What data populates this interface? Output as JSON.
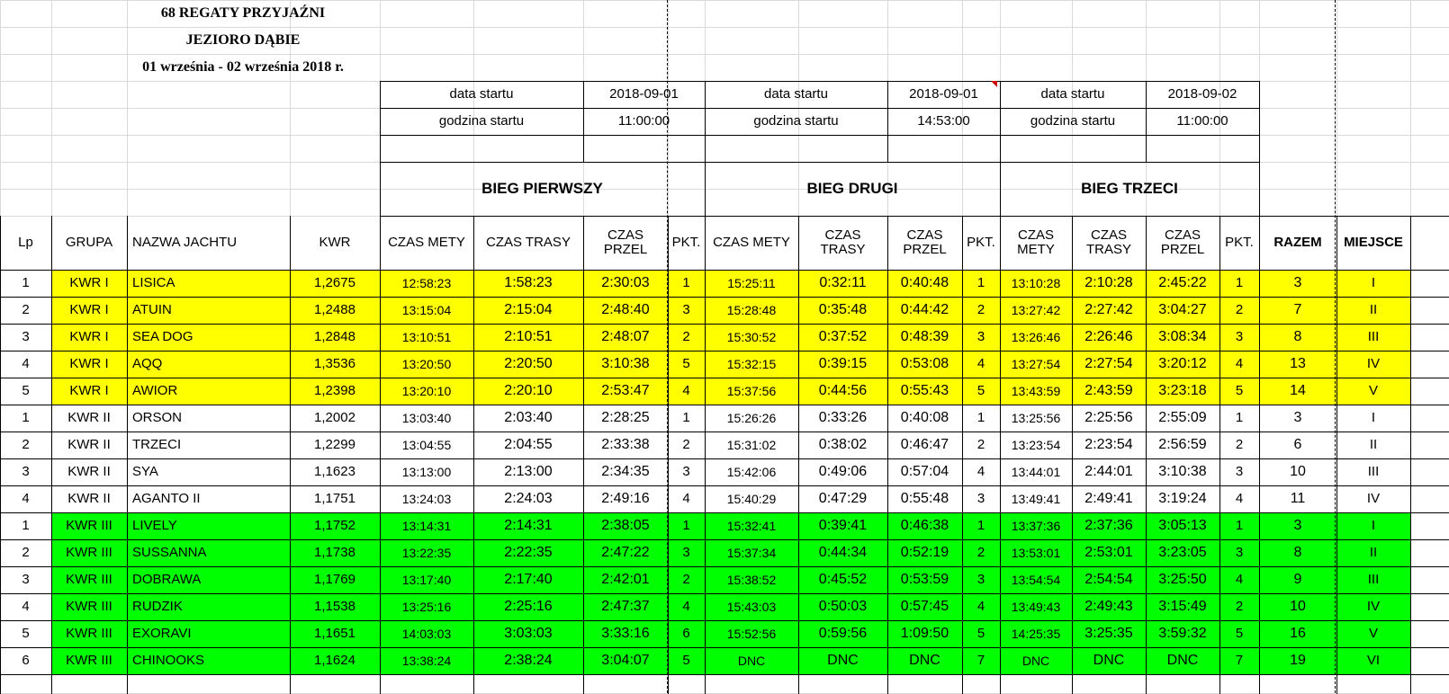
{
  "title": {
    "line1": "68 REGATY PRZYJAŹNI",
    "line2": "JEZIORO DĄBIE",
    "line3": "01 września -  02 września 2018 r."
  },
  "starts": [
    {
      "date_label": "data startu",
      "date": "2018-09-01",
      "time_label": "godzina startu",
      "time": "11:00:00",
      "race": "BIEG PIERWSZY"
    },
    {
      "date_label": "data startu",
      "date": "2018-09-01",
      "time_label": "godzina startu",
      "time": "14:53:00",
      "race": "BIEG  DRUGI"
    },
    {
      "date_label": "data startu",
      "date": "2018-09-02",
      "time_label": "godzina startu",
      "time": "11:00:00",
      "race": "BIEG TRZECI"
    }
  ],
  "columns": [
    "Lp",
    "GRUPA",
    "NAZWA JACHTU",
    "KWR",
    "CZAS METY",
    "CZAS TRASY",
    "CZAS PRZEL",
    "PKT.",
    "CZAS METY",
    "CZAS TRASY",
    "CZAS PRZEL",
    "PKT.",
    "CZAS METY",
    "CZAS TRASY",
    "CZAS PRZEL",
    "PKT.",
    "RAZEM",
    "MIEJSCE"
  ],
  "colors": {
    "kwr1": "#ffff00",
    "kwr2": "#ffffff",
    "kwr3": "#00ff00",
    "grid": "#d9d9d9"
  },
  "rows": [
    {
      "cells": [
        "1",
        "KWR I",
        "LISICA",
        "1,2675",
        "12:58:23",
        "1:58:23",
        "2:30:03",
        "1",
        "15:25:11",
        "0:32:11",
        "0:40:48",
        "1",
        "13:10:28",
        "2:10:28",
        "2:45:22",
        "1",
        "3",
        "I"
      ],
      "group": "kwr1"
    },
    {
      "cells": [
        "2",
        "KWR I",
        "ATUIN",
        "1,2488",
        "13:15:04",
        "2:15:04",
        "2:48:40",
        "3",
        "15:28:48",
        "0:35:48",
        "0:44:42",
        "2",
        "13:27:42",
        "2:27:42",
        "3:04:27",
        "2",
        "7",
        "II"
      ],
      "group": "kwr1"
    },
    {
      "cells": [
        "3",
        "KWR I",
        "SEA DOG",
        "1,2848",
        "13:10:51",
        "2:10:51",
        "2:48:07",
        "2",
        "15:30:52",
        "0:37:52",
        "0:48:39",
        "3",
        "13:26:46",
        "2:26:46",
        "3:08:34",
        "3",
        "8",
        "III"
      ],
      "group": "kwr1"
    },
    {
      "cells": [
        "4",
        "KWR I",
        "AQQ",
        "1,3536",
        "13:20:50",
        "2:20:50",
        "3:10:38",
        "5",
        "15:32:15",
        "0:39:15",
        "0:53:08",
        "4",
        "13:27:54",
        "2:27:54",
        "3:20:12",
        "4",
        "13",
        "IV"
      ],
      "group": "kwr1"
    },
    {
      "cells": [
        "5",
        "KWR I",
        "AWIOR",
        "1,2398",
        "13:20:10",
        "2:20:10",
        "2:53:47",
        "4",
        "15:37:56",
        "0:44:56",
        "0:55:43",
        "5",
        "13:43:59",
        "2:43:59",
        "3:23:18",
        "5",
        "14",
        "V"
      ],
      "group": "kwr1"
    },
    {
      "cells": [
        "1",
        "KWR II",
        "ORSON",
        "1,2002",
        "13:03:40",
        "2:03:40",
        "2:28:25",
        "1",
        "15:26:26",
        "0:33:26",
        "0:40:08",
        "1",
        "13:25:56",
        "2:25:56",
        "2:55:09",
        "1",
        "3",
        "I"
      ],
      "group": "kwr2"
    },
    {
      "cells": [
        "2",
        "KWR II",
        "TRZECI",
        "1,2299",
        "13:04:55",
        "2:04:55",
        "2:33:38",
        "2",
        "15:31:02",
        "0:38:02",
        "0:46:47",
        "2",
        "13:23:54",
        "2:23:54",
        "2:56:59",
        "2",
        "6",
        "II"
      ],
      "group": "kwr2"
    },
    {
      "cells": [
        "3",
        "KWR II",
        "SYA",
        "1,1623",
        "13:13:00",
        "2:13:00",
        "2:34:35",
        "3",
        "15:42:06",
        "0:49:06",
        "0:57:04",
        "4",
        "13:44:01",
        "2:44:01",
        "3:10:38",
        "3",
        "10",
        "III"
      ],
      "group": "kwr2"
    },
    {
      "cells": [
        "4",
        "KWR II",
        "AGANTO II",
        "1,1751",
        "13:24:03",
        "2:24:03",
        "2:49:16",
        "4",
        "15:40:29",
        "0:47:29",
        "0:55:48",
        "3",
        "13:49:41",
        "2:49:41",
        "3:19:24",
        "4",
        "11",
        "IV"
      ],
      "group": "kwr2"
    },
    {
      "cells": [
        "1",
        "KWR III",
        "LIVELY",
        "1,1752",
        "13:14:31",
        "2:14:31",
        "2:38:05",
        "1",
        "15:32:41",
        "0:39:41",
        "0:46:38",
        "1",
        "13:37:36",
        "2:37:36",
        "3:05:13",
        "1",
        "3",
        "I"
      ],
      "group": "kwr3"
    },
    {
      "cells": [
        "2",
        "KWR III",
        "SUSSANNA",
        "1,1738",
        "13:22:35",
        "2:22:35",
        "2:47:22",
        "3",
        "15:37:34",
        "0:44:34",
        "0:52:19",
        "2",
        "13:53:01",
        "2:53:01",
        "3:23:05",
        "3",
        "8",
        "II"
      ],
      "group": "kwr3"
    },
    {
      "cells": [
        "3",
        "KWR III",
        "DOBRAWA",
        "1,1769",
        "13:17:40",
        "2:17:40",
        "2:42:01",
        "2",
        "15:38:52",
        "0:45:52",
        "0:53:59",
        "3",
        "13:54:54",
        "2:54:54",
        "3:25:50",
        "4",
        "9",
        "III"
      ],
      "group": "kwr3"
    },
    {
      "cells": [
        "4",
        "KWR III",
        "RUDZIK",
        "1,1538",
        "13:25:16",
        "2:25:16",
        "2:47:37",
        "4",
        "15:43:03",
        "0:50:03",
        "0:57:45",
        "4",
        "13:49:43",
        "2:49:43",
        "3:15:49",
        "2",
        "10",
        "IV"
      ],
      "group": "kwr3"
    },
    {
      "cells": [
        "5",
        "KWR III",
        "EXORAVI",
        "1,1651",
        "14:03:03",
        "3:03:03",
        "3:33:16",
        "6",
        "15:52:56",
        "0:59:56",
        "1:09:50",
        "5",
        "14:25:35",
        "3:25:35",
        "3:59:32",
        "5",
        "16",
        "V"
      ],
      "group": "kwr3"
    },
    {
      "cells": [
        "6",
        "KWR III",
        "CHINOOKS",
        "1,1624",
        "13:38:24",
        "2:38:24",
        "3:04:07",
        "5",
        "DNC",
        "DNC",
        "DNC",
        "7",
        "DNC",
        "DNC",
        "DNC",
        "7",
        "19",
        "VI"
      ],
      "group": "kwr3"
    }
  ]
}
